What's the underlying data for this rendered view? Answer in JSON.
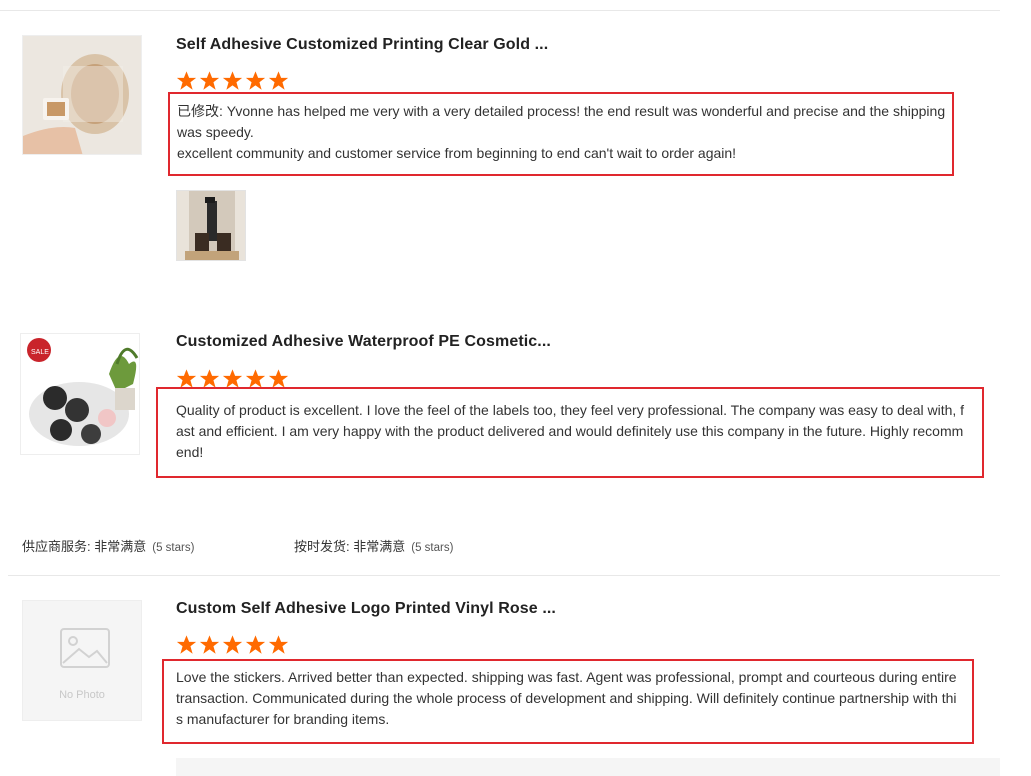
{
  "reviews": [
    {
      "product_title": "Self Adhesive Customized Printing Clear Gold ...",
      "rating": 5,
      "text": "已修改: Yvonne has helped me very with a very detailed process! the end result was wonderful and precise and the shipping was speedy.\nexcellent community and customer service from beginning to end can't wait to order again!",
      "image": "product-photo-roll-labels",
      "attached_photo": "customer-photo-bottles"
    },
    {
      "product_title": "Customized Adhesive Waterproof PE Cosmetic...",
      "rating": 5,
      "text": "Quality of product is excellent.  I love the feel of the labels too, they feel very professional.  The company was easy to deal with, fast and efficient.  I am very happy with the product delivered and would definitely use this company in the future.  Highly recommend!",
      "image": "product-photo-sale-labels"
    },
    {
      "product_title": "Custom Self Adhesive Logo Printed Vinyl Rose ...",
      "rating": 5,
      "text": "Love the stickers. Arrived better than expected. shipping was fast. Agent was professional, prompt and courteous during entire transaction. Communicated during the whole process of development and shipping. Will definitely continue partnership with this manufacturer for branding items.",
      "image": "no-photo-icon",
      "no_photo_label": "No Photo"
    }
  ],
  "supplier_ratings": {
    "service_label": "供应商服务: 非常满意",
    "service_note": "(5 stars)",
    "shipping_label": "按时发货: 非常满意",
    "shipping_note": "(5 stars)"
  },
  "colors": {
    "star": "#ff6a00",
    "highlight_box": "#e0282e"
  }
}
